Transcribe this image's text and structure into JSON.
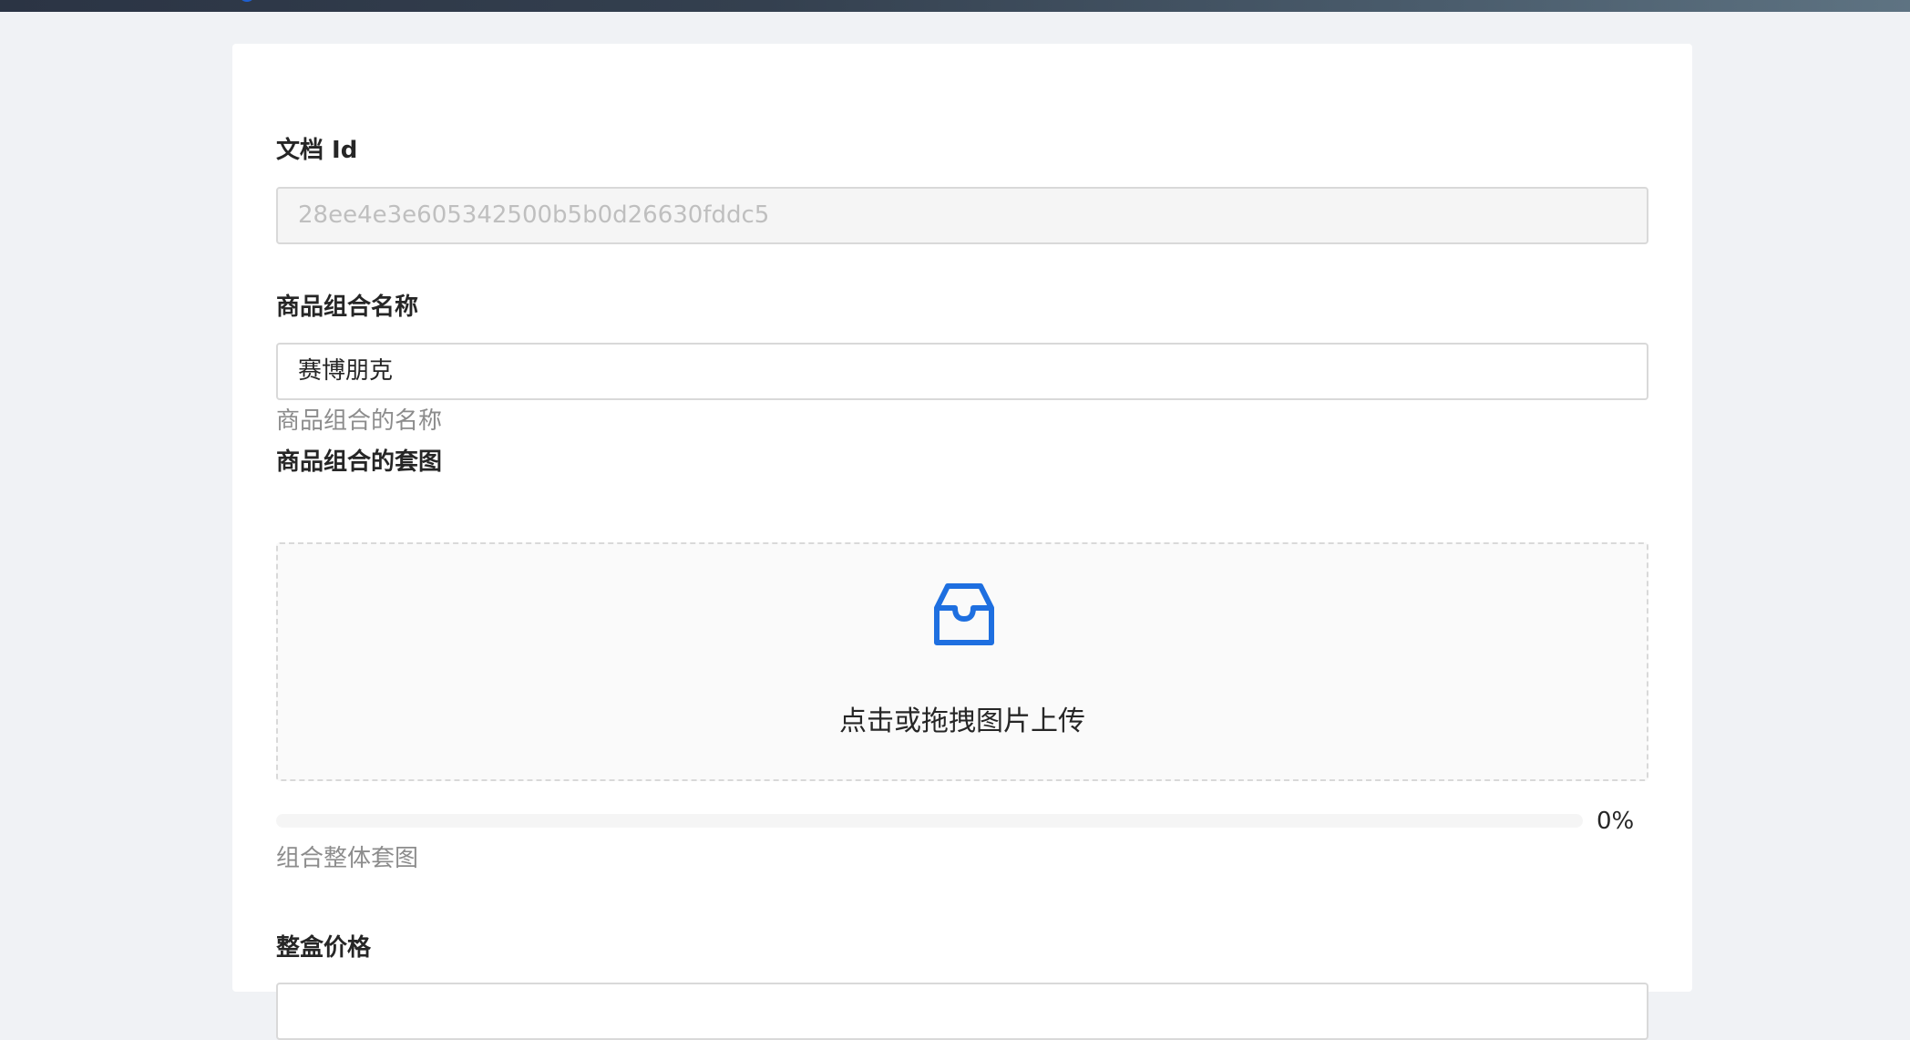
{
  "form": {
    "doc_id": {
      "label": "文档 Id",
      "value": "28ee4e3e605342500b5b0d26630fddc5"
    },
    "bundle_name": {
      "label": "商品组合名称",
      "value": "赛博朋克",
      "help": "商品组合的名称"
    },
    "bundle_image": {
      "label": "商品组合的套图",
      "upload_hint": "点击或拖拽图片上传",
      "progress_percent": 0,
      "progress_text": "0%",
      "help": "组合整体套图",
      "icon": "inbox-icon"
    },
    "box_price": {
      "label": "整盒价格",
      "value": ""
    }
  },
  "colors": {
    "primary": "#1e6fe0",
    "page_background": "#f0f2f5",
    "card_background": "#ffffff",
    "border": "#d9d9d9",
    "help_text": "#8c8c8c"
  }
}
